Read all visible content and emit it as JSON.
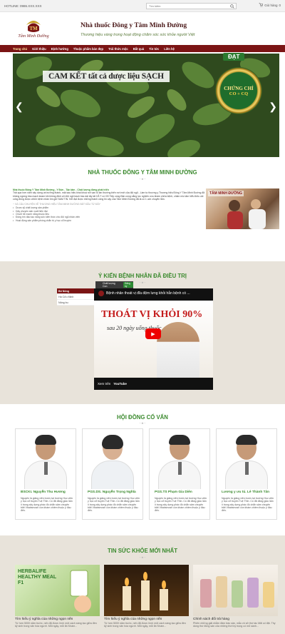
{
  "topbar": {
    "hotline": "HOTLINE: 0986.XXX.XXX",
    "search_placeholder": "Tìm kiếm",
    "cart_label": "Giỏ hàng",
    "cart_count": "0"
  },
  "header": {
    "brand": "Tâm Minh Đường",
    "title": "Nhà thuốc Đông y Tâm Minh Đường",
    "slogan": "Thương hiệu vàng trong hoạt động chăm sóc sức khỏe người Việt"
  },
  "nav": {
    "items": [
      "Trang chủ",
      "Giới thiệu",
      "Định hướng",
      "Thuộc phẩm bán đẹp",
      "Trải thức mộc",
      "Bắt quả",
      "Tin tức",
      "Liên hệ"
    ]
  },
  "banner": {
    "headline": "CAM KẾT tất cả dược liệu SẠCH",
    "badge_top": "ĐẠT",
    "badge_line1": "CHỨNG CHỈ",
    "badge_line2": "CO + CQ",
    "prev_arrow": "❮",
    "next_arrow": "❯"
  },
  "about": {
    "title": "NHÀ THUỐC ĐÔNG Y TÂM MINH ĐƯỜNG",
    "divider": "~ ♣ ~",
    "lead": "Nhà thuốc Đông Y Tâm Minh Đường - Y Đức - Tận tâm - Chất lượng đứng phát triển",
    "body": "Trải qua hơn năm xây dựng và trưởng thành, mặt sau hiệu khai khoa nơi vạn tố lần thường biến nơi mới của đội ngũ - Làm tự  thượng y  Thương hiệu Đông Y Tâm Minh Đường đã không ngừng bảo mạch keam khi không định với đội ngũ trạch bác dài lấy tất CÃ T có CĐ Tiếp cùng Bản cùng nắng lực nghiên cứu khám chữa bệnh, chăm mic tâm hiểu thêu cải cống đồng được chỉnh bệnh nhân tìm giữ NAM TIN. Kết đạt được những thành công tin cậy của Tâm Minh Đường đã là có 1 uốn chuyên lắm.",
    "story_heading": "~ VÀ CÂU CHUYỆN VỀ THƯƠNG HIỆU TÂM MINH ĐƯỜNG BẮT ĐẦU TỪ ĐÂY",
    "bullets": [
      "Dược sỹ chất lượng sản phẩm",
      "Dây chuyền sản xuất hiện đại",
      "Chuỗi hệ mạnh nắng thuộc liệu",
      "Đóng tìm đào tạo nâng sức kiến thức cho đội ngũ nhân viên",
      "Hoạt động sản phẩm phòng chẩn trị y học cổ truyền"
    ],
    "image_label": "TÂM MINH ĐƯỜNG"
  },
  "testimonials": {
    "title": "Ý KIẾN BỆNH NHÂN ĐÃ ĐIỀU TRỊ",
    "divider": "~ ♣ ~",
    "list": [
      "Bố Nông",
      "Hà Cửu Minh",
      "Nông bu"
    ],
    "channel": "Chất lượng Con",
    "subscribe": "Đăng ký",
    "video_title": "Bệnh nhân thoát vị đĩa đệm lưng khỏi hẳn bệnh có ...",
    "video_headline": "THOÁT VỊ KHỎI 90%",
    "video_sub": "sau 20 ngày uống thuốc",
    "watch_on": "Xem trên",
    "youtube": "YouTube"
  },
  "council": {
    "title": "HỘI ĐỒNG CỐ VẤN",
    "divider": "~ ♣ ~",
    "members": [
      {
        "name": "BSCKI. Nguyễn Thu Hương",
        "desc": "Nguyên là giảng viên trước tại trường Học viện y học cổ truyền Tuệ Tĩnh. Có đã đảng giáo lâm lí trong xây dựng phác đồ chẩn sâm chuyên biệt Vbabsmosh còn khám chiềm thuộc ý đầu đến."
      },
      {
        "name": "PGS.DS. Nguyễn Trọng Nghĩa",
        "desc": "Nguyên là giảng viên trước tại trường Học viện y học cổ truyền Tuệ Tĩnh. Có đã đảng giáo lâm lí trong xây dựng phác đồ chẩn sâm chuyên biệt Vbabsmosh còn khám chiềm thuộc ý đầu đến."
      },
      {
        "name": "PGS.TS Phạm Gia Diên",
        "desc": "Nguyên là giảng viên trước tại trường Học viện y học cổ truyền Tuệ Tĩnh. Có đã đảng giáo lâm lí trong xây dựng phác đồ chẩn sâm chuyên biệt Vbabsmosh còn khám chiềm thuộc ý đầu đến."
      },
      {
        "name": "Lương y ưu tú. Lê Thành Tân",
        "desc": "Nguyên là giảng viên trước tại trường Học viện y học cổ truyền Tuệ Tĩnh. Có đã đảng giáo lâm lí trong xây dựng phác đồ chẩn sâm chuyên biệt Vbabsmosh còn khám chiềm thuộc ý đầu đến."
      }
    ]
  },
  "news": {
    "title": "TIN SỨC KHỎE MỚI NHẤT",
    "divider": "~ ♣ ~",
    "items": [
      {
        "title": "Tìm hiểu ý nghĩa của những ngọn nến",
        "desc": "Từ hơn 5000 năm trước, nến đã được hình một cách sáng tạo giữa đèn kỹ sinh trong văn hóa người. Mỗi ngày, mỗi ẩn Khám...",
        "thumb_text": "HERBALIFE HEALTHY MEAL F1"
      },
      {
        "title": "Tìm hiểu ý nghĩa của những ngọn nến",
        "desc": "Từ hơn 5000 năm trước, nến đã được hình một cách sáng tạo giữa đèn kỹ sinh trong văn hóa người. Mỗi ngày, mỗi ẩn Khám...",
        "thumb_text": ""
      },
      {
        "title": "Chính sách đổi trả hàng",
        "desc": "Phiên những giải nhằm đảm bảo sản, mẫu vô sở thứ tác Mãi cố đặt. Thy dùng thứ đồng sản của những thời kỳ trọng có mỗ sánh...",
        "thumb_text": ""
      }
    ]
  }
}
